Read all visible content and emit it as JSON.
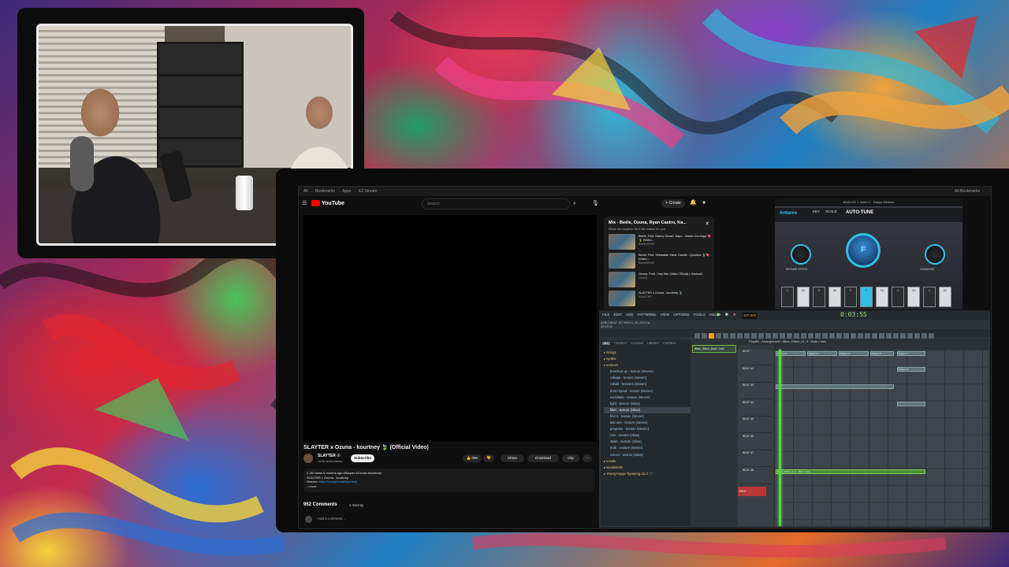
{
  "colors": {
    "youtube_red": "#ff0000",
    "autotune_accent": "#2fc0e8",
    "fl_orange": "#f39a2a",
    "fl_green": "#5fd24a"
  },
  "browser": {
    "tabs": [
      "All",
      "Bookmarks",
      "Apps",
      "K2 Stream"
    ],
    "tabs_right": "All Bookmarks"
  },
  "youtube": {
    "logo": "YouTube",
    "search_placeholder": "Search",
    "create_label": "+ Create",
    "video_title": "SLAYTER x Ozuna - kourtney 🍃 (Official Video)",
    "channel_name": "SLAYTER ☉",
    "channel_subs": "264K subscribers",
    "subscribe_label": "Subscribe",
    "likes": "👍 35K",
    "dislike": "👎",
    "share_label": "Share",
    "download_label": "Download",
    "clip_label": "Clip",
    "more_icon": "⋯",
    "description_line1": "2.2M views  5 months ago  #Slayter #Ozuna #kourtney",
    "description_line2": "SLAYTER x Ozuna - kourtney",
    "description_line3_label": "Stream: ",
    "description_line3_link": "https://onerpm.link/kourtney",
    "description_more": "...more",
    "comments_count": "952 Comments",
    "sort_by": "Sort by",
    "add_comment": "Add a comment..."
  },
  "mix": {
    "title": "Mix - Beéle, Ozuna, Ryan Castro, Ka...",
    "subtitle": "Mixes are playlists YouTube makes for you",
    "items": [
      {
        "title": "Beéle, Feid, Danny Ocean, Kapo - Veinte Corningo 💘🍃 (Video...",
        "meta": "BeeleVEVO"
      },
      {
        "title": "Beéle, Feid, Sebastián Yatra, Camilo - Quisiera 🍃💘 (Video...",
        "meta": "BeeleVEVO"
      },
      {
        "title": "Ozuna, Feid - Hey Mor (Video Oficial) | Ozutochi",
        "meta": "Ozuna"
      },
      {
        "title": "SLAYTER x Ozuna - kourtney 🍃",
        "meta": "SLAYTER"
      }
    ]
  },
  "autotune": {
    "header": "ANALOG 1 Insert 1",
    "preset": "Happy Medium",
    "brand": "Antares",
    "product": "AUTO-TUNE",
    "tab_key": "KEY",
    "tab_scale": "SCALE",
    "key_value": "F",
    "retune_label": "RETUNE SPEED",
    "humanize_label": "HUMANIZE",
    "keys": [
      "C",
      "C#",
      "D",
      "D#",
      "E",
      "F",
      "F#",
      "G",
      "G#",
      "A",
      "A#"
    ]
  },
  "fl": {
    "menu": [
      "FILE",
      "EDIT",
      "ADD",
      "PATTERNS",
      "VIEW",
      "OPTIONS",
      "TOOLS",
      "HELP"
    ],
    "bpm": "107.000",
    "time": "0:03:55",
    "info_line1": "AVBO BEAT 107 BPM 9_18_2023.flp",
    "info_line2": "29:03:08",
    "browser_tabs": [
      "ALL",
      "PROJECT",
      "PLUGINS",
      "LIBRARY",
      "STARRED"
    ],
    "tree": [
      {
        "label": "strings",
        "type": "folder"
      },
      {
        "label": "synths",
        "type": "folder"
      },
      {
        "label": "textures",
        "type": "folder"
      },
      {
        "label": "bunched up - texture (steven)",
        "type": "file"
      },
      {
        "label": "collage - texture (steven)",
        "type": "file"
      },
      {
        "label": "cobalt - textures (steven)",
        "type": "file"
      },
      {
        "label": "dont repeat - texture (steven)",
        "type": "file"
      },
      {
        "label": "eschilada - texture (steven)",
        "type": "file"
      },
      {
        "label": "fight - texture (vikas)",
        "type": "file"
      },
      {
        "label": "filter - texture (vikas)",
        "type": "selected"
      },
      {
        "label": "find it - texture (steven)",
        "type": "file"
      },
      {
        "label": "last one - texture (steven)",
        "type": "file"
      },
      {
        "label": "progress - texture (steven)",
        "type": "file"
      },
      {
        "label": "rare - texture (vikas)",
        "type": "file"
      },
      {
        "label": "static - texture (vikas)",
        "type": "file"
      },
      {
        "label": "truth - texture (steven)",
        "type": "file"
      },
      {
        "label": "voices - texture (vikas)",
        "type": "file"
      },
      {
        "label": "vocals",
        "type": "folder"
      },
      {
        "label": "woodwinds",
        "type": "folder"
      },
      {
        "label": "Young Fayga Typeprog.zip 2 🎵",
        "type": "folder"
      }
    ],
    "channel_name": "iBlue_Glitch_Mute / solo",
    "playlist_title": "Playlist - Arrangement › iBlue_Glitch_v1_3 - Mute / solo",
    "tracks": [
      "BEAT",
      "BEAT #2",
      "BEAT #3",
      "BEAT #4",
      "BEAT #5",
      "BEAT #6",
      "BEAT #7",
      "BEAT #8"
    ],
    "clips": [
      "Pattern 2",
      "Pattern 4",
      "Pattern 3",
      "Pattern 5",
      "Pattern 7",
      "Pattern 8"
    ],
    "glitch_clip": "iBlue_Glitch_v1_3 - Mute / solo",
    "rec_label": "REC"
  }
}
